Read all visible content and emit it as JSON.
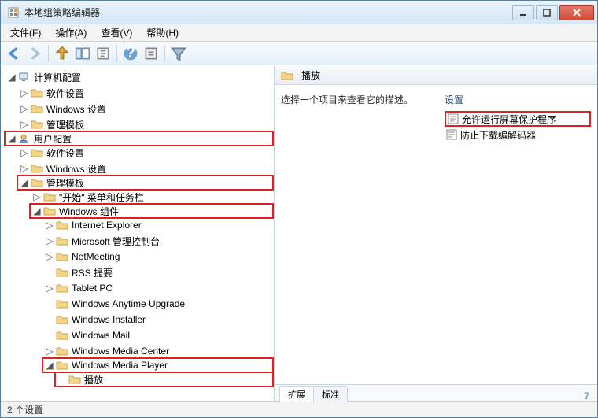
{
  "window": {
    "title": "本地组策略编辑器"
  },
  "menu": {
    "file": "文件(F)",
    "action": "操作(A)",
    "view": "查看(V)",
    "help": "帮助(H)"
  },
  "tree": {
    "root": "计算机配置",
    "root_children": {
      "software": "软件设置",
      "windows": "Windows 设置",
      "admin": "管理模板"
    },
    "user": "用户配置",
    "user_children": {
      "software": "软件设置",
      "windows": "Windows 设置",
      "admin": "管理模板",
      "startmenu": "\"开始\" 菜单和任务栏",
      "components": "Windows 组件",
      "ie": "Internet Explorer",
      "mmc": "Microsoft 管理控制台",
      "netmeeting": "NetMeeting",
      "rss": "RSS 提要",
      "tablet": "Tablet PC",
      "anytime": "Windows Anytime Upgrade",
      "installer": "Windows Installer",
      "mail": "Windows Mail",
      "mediacenter": "Windows Media Center",
      "wmp": "Windows Media Player",
      "playback": "播放"
    }
  },
  "right": {
    "header_title": "播放",
    "desc_text": "选择一个项目来查看它的描述。",
    "settings_header": "设置",
    "setting1": "允许运行屏幕保护程序",
    "setting2": "防止下载编解码器"
  },
  "tabs": {
    "extended": "扩展",
    "standard": "标准"
  },
  "status": {
    "text": "2 个设置"
  }
}
